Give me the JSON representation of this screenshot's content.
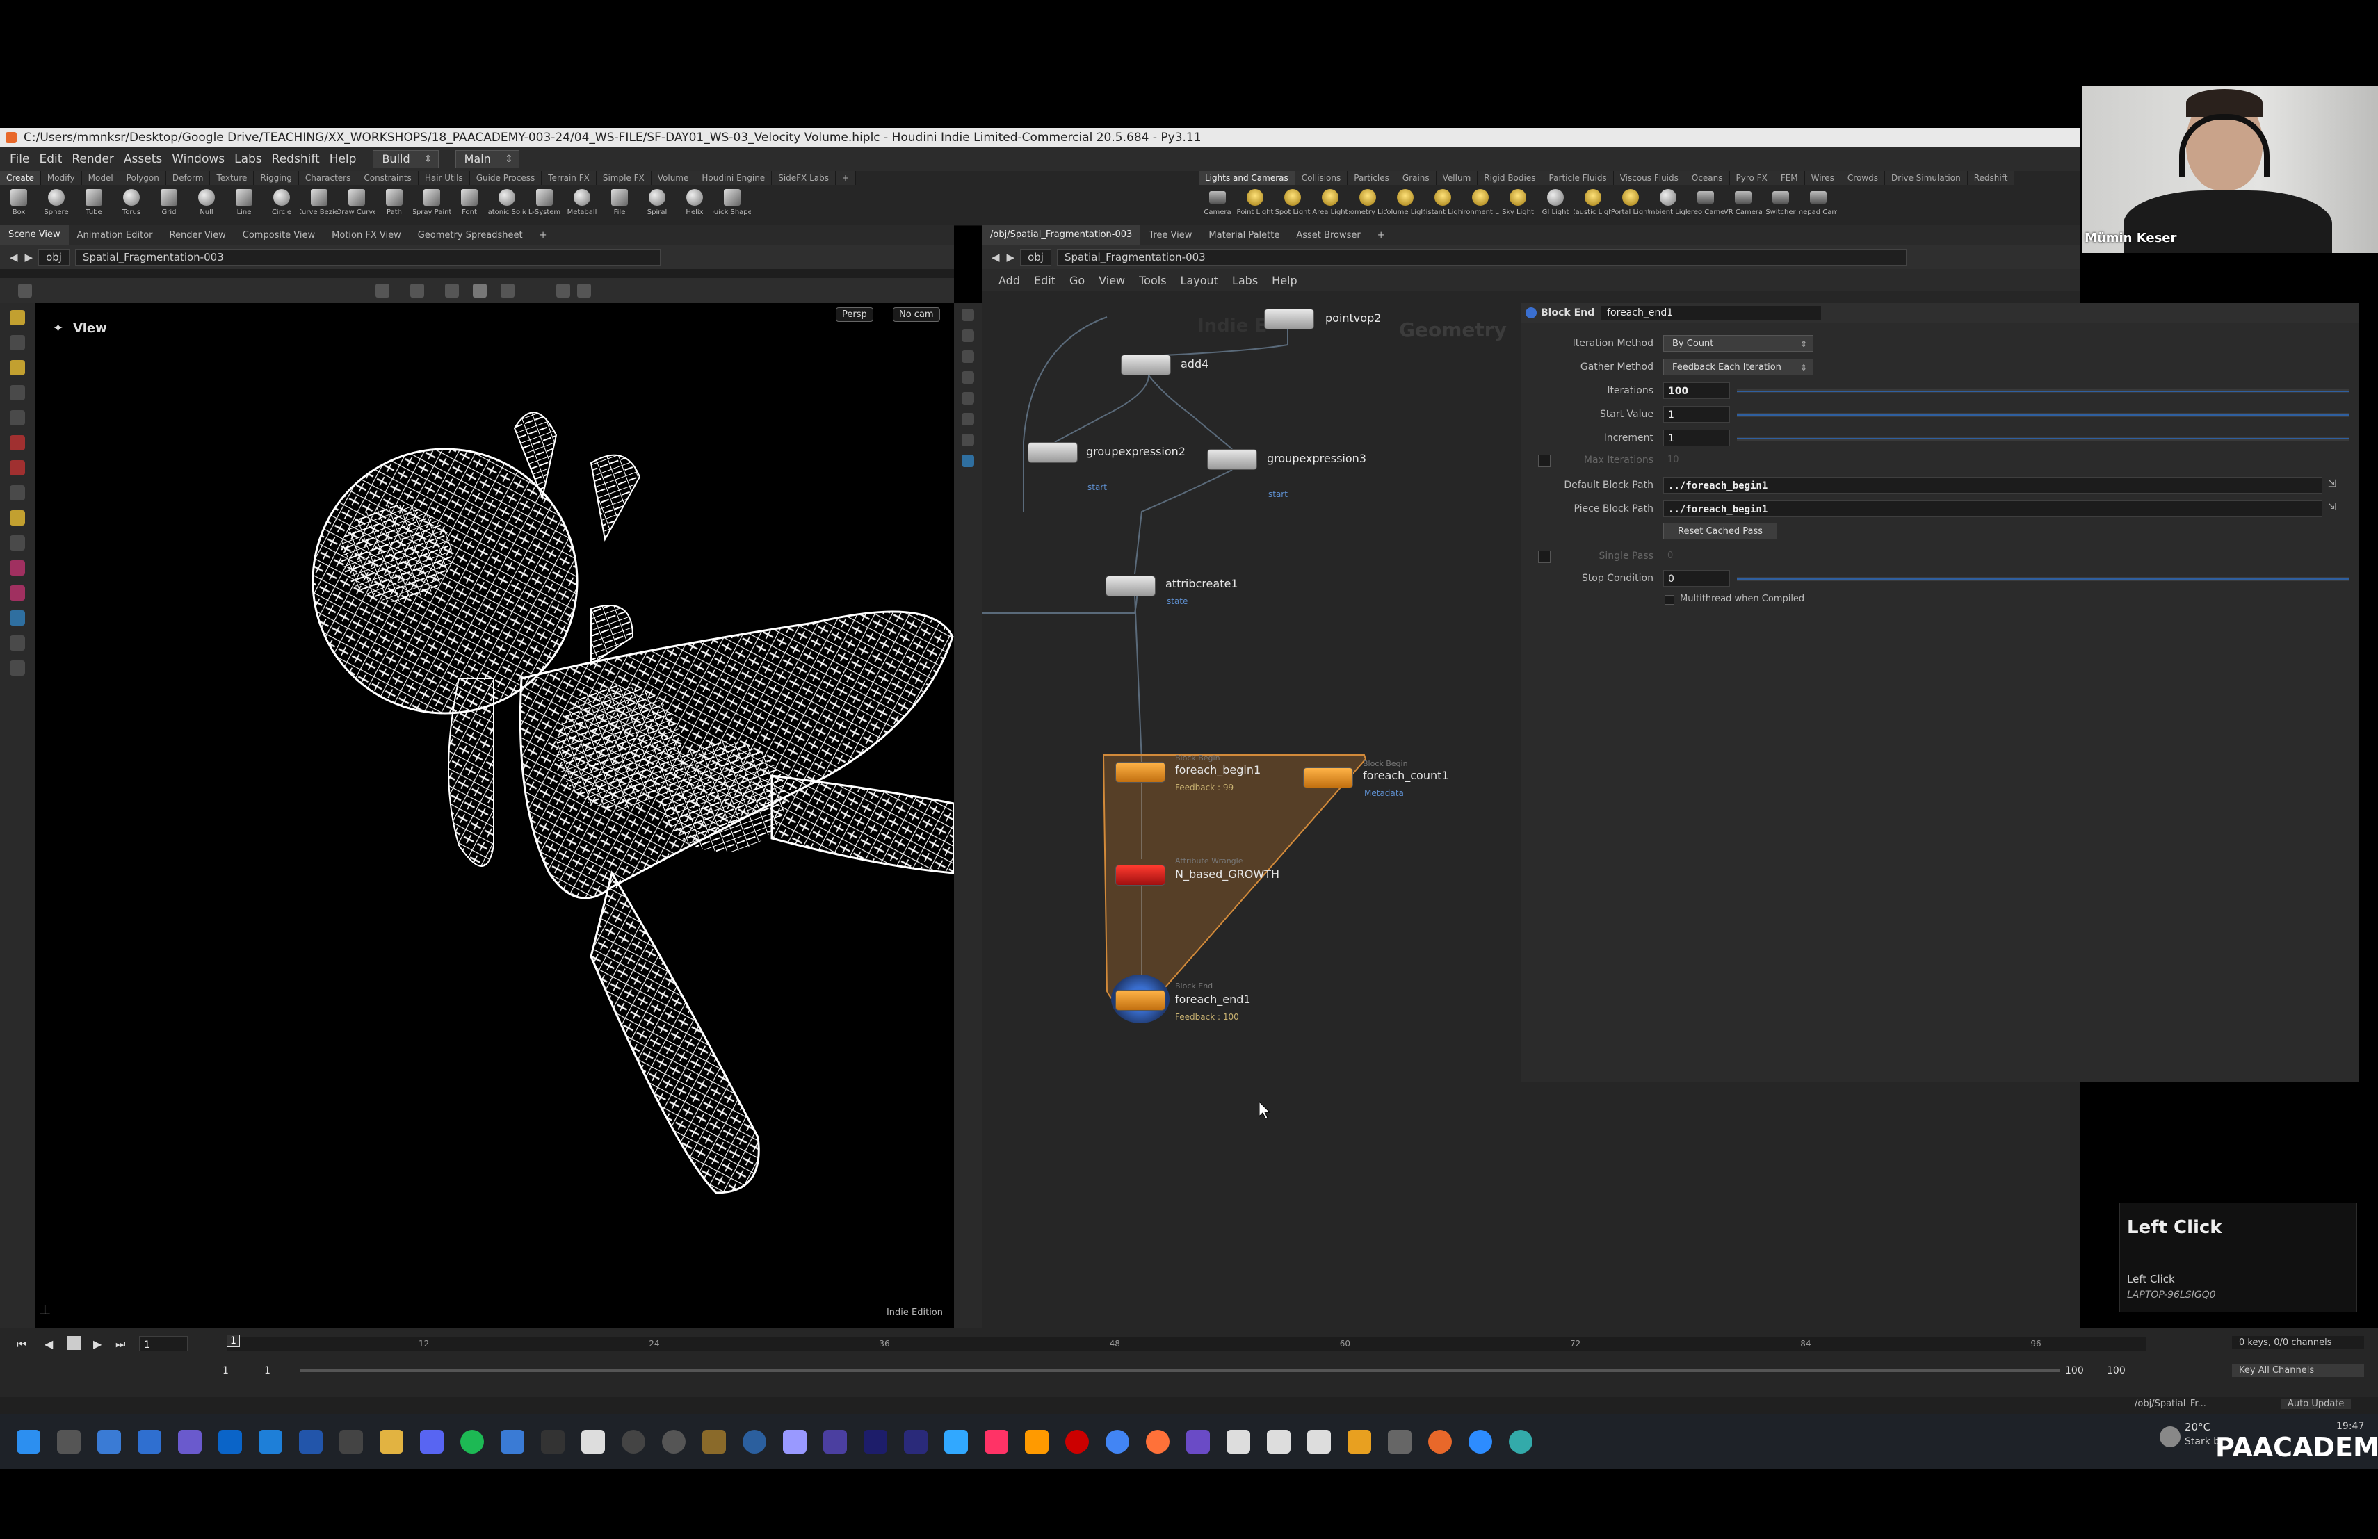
{
  "window": {
    "title": "C:/Users/mmnksr/Desktop/Google Drive/TEACHING/XX_WORKSHOPS/18_PAACADEMY-003-24/04_WS-FILE/SF-DAY01_WS-03_Velocity Volume.hiplc - Houdini Indie Limited-Commercial 20.5.684 - Py3.11"
  },
  "menu": {
    "items": [
      "File",
      "Edit",
      "Render",
      "Assets",
      "Windows",
      "Labs",
      "Redshift",
      "Help"
    ],
    "desktop_dropdown": "Build",
    "main_dropdown": "Main"
  },
  "shelf_left": {
    "tabs": [
      "Create",
      "Modify",
      "Model",
      "Polygon",
      "Deform",
      "Texture",
      "Rigging",
      "Characters",
      "Constraints",
      "Hair Utils",
      "Guide Process",
      "Terrain FX",
      "Simple FX",
      "Volume",
      "Houdini Engine",
      "SideFX Labs"
    ],
    "tools": [
      "Box",
      "Sphere",
      "Tube",
      "Torus",
      "Grid",
      "Null",
      "Line",
      "Circle",
      "Curve Bezier",
      "Draw Curve",
      "Path",
      "Spray Paint",
      "Font",
      "Platonic Solids",
      "L-System",
      "Metaball",
      "File",
      "Spiral",
      "Helix",
      "Quick Shapes"
    ]
  },
  "shelf_right": {
    "tabs": [
      "Lights and Cameras",
      "Collisions",
      "Particles",
      "Grains",
      "Vellum",
      "Rigid Bodies",
      "Particle Fluids",
      "Viscous Fluids",
      "Oceans",
      "Pyro FX",
      "FEM",
      "Wires",
      "Crowds",
      "Drive Simulation",
      "Redshift"
    ],
    "tools": [
      "Camera",
      "Point Light",
      "Spot Light",
      "Area Light",
      "Geometry Light",
      "Volume Light",
      "Distant Light",
      "Environment Light",
      "Sky Light",
      "GI Light",
      "Caustic Light",
      "Portal Light",
      "Ambient Light",
      "Stereo Camera",
      "VR Camera",
      "Switcher",
      "Gamepad Camera"
    ]
  },
  "left_pane": {
    "tabs": [
      "Scene View",
      "Animation Editor",
      "Render View",
      "Composite View",
      "Motion FX View",
      "Geometry Spreadsheet"
    ],
    "path_root": "obj",
    "path_node": "Spatial_Fragmentation-003",
    "viewport_label": "View",
    "persp_button": "Persp",
    "cam_button": "No cam",
    "edition": "Indie Edition"
  },
  "right_pane": {
    "tabs": [
      "/obj/Spatial_Fragmentation-003",
      "Tree View",
      "Material Palette",
      "Asset Browser"
    ],
    "path_root": "obj",
    "path_node": "Spatial_Fragmentation-003",
    "net_menu": [
      "Add",
      "Edit",
      "Go",
      "View",
      "Tools",
      "Layout",
      "Labs",
      "Help"
    ],
    "context_label": "Geometry",
    "watermark": "Indie E"
  },
  "nodes": {
    "pointvop2": "pointvop2",
    "add4": "add4",
    "groupexpression2": "groupexpression2",
    "groupexpression2_sub": "start",
    "groupexpression3": "groupexpression3",
    "groupexpression3_sub": "start",
    "attribcreate1": "attribcreate1",
    "attribcreate1_sub": "state",
    "foreach_begin1_type": "Block Begin",
    "foreach_begin1": "foreach_begin1",
    "foreach_begin1_sub": "Feedback : 99",
    "foreach_count1_type": "Block Begin",
    "foreach_count1": "foreach_count1",
    "foreach_count1_sub": "Metadata",
    "growth_type": "Attribute Wrangle",
    "growth": "N_based_GROWTH",
    "foreach_end1_type": "Block End",
    "foreach_end1": "foreach_end1",
    "foreach_end1_sub": "Feedback : 100"
  },
  "params": {
    "node_type": "Block End",
    "node_name": "foreach_end1",
    "iteration_method_label": "Iteration Method",
    "iteration_method": "By Count",
    "gather_method_label": "Gather Method",
    "gather_method": "Feedback Each Iteration",
    "iterations_label": "Iterations",
    "iterations": "100",
    "start_value_label": "Start Value",
    "start_value": "1",
    "increment_label": "Increment",
    "increment": "1",
    "max_iterations_label": "Max Iterations",
    "max_iterations": "10",
    "default_block_path_label": "Default Block Path",
    "default_block_path": "../foreach_begin1",
    "piece_block_path_label": "Piece Block Path",
    "piece_block_path": "../foreach_begin1",
    "reset_button": "Reset Cached Pass",
    "single_pass_label": "Single Pass",
    "single_pass": "0",
    "stop_condition_label": "Stop Condition",
    "stop_condition": "0",
    "multithread_label": "Multithread when Compiled"
  },
  "timeline": {
    "current_frame": "1",
    "frame_field": "1",
    "range_start": "1",
    "range_start2": "1",
    "range_end": "100",
    "range_end2": "100",
    "ticks": [
      "1",
      "12",
      "24",
      "36",
      "48",
      "60",
      "72",
      "84",
      "96"
    ],
    "keys_label": "0 keys, 0/0 channels",
    "key_all_label": "Key All Channels",
    "obj_path": "/obj/Spatial_Fr...",
    "update_mode": "Auto Update"
  },
  "taskbar": {
    "weather_temp": "20°C",
    "weather_text": "Stark b",
    "time": "19:47"
  },
  "overlay": {
    "presenter_name": "Mümin Keser",
    "click_title": "Left Click",
    "click_detail": "Left Click",
    "click_device": "LAPTOP-96LSIGQ0",
    "brand": "PAACADEMY"
  }
}
